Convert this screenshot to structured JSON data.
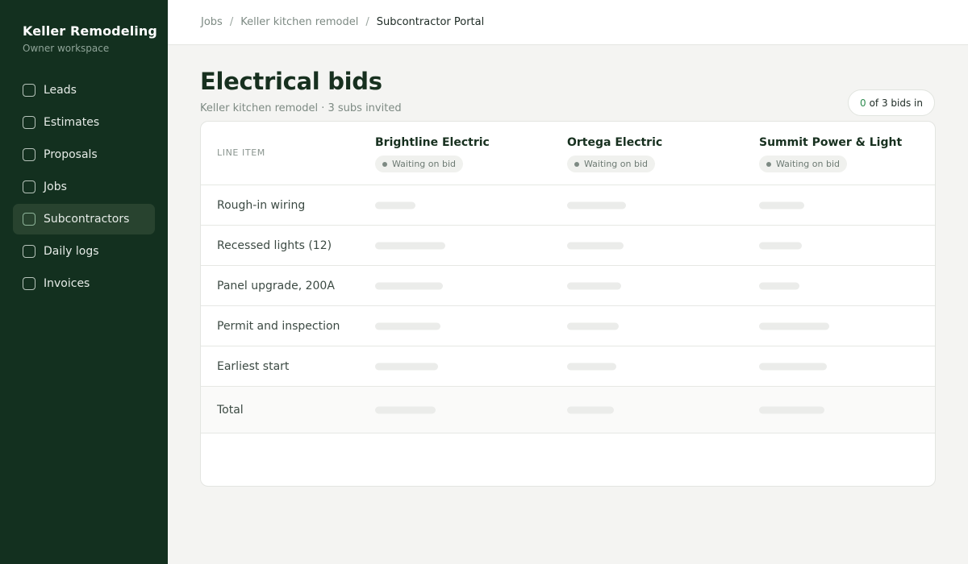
{
  "sidebar": {
    "brand": "Keller Remodeling",
    "workspace": "Owner workspace",
    "items": [
      {
        "label": "Leads",
        "active": false
      },
      {
        "label": "Estimates",
        "active": false
      },
      {
        "label": "Proposals",
        "active": false
      },
      {
        "label": "Jobs",
        "active": false
      },
      {
        "label": "Subcontractors",
        "active": true
      },
      {
        "label": "Daily logs",
        "active": false
      },
      {
        "label": "Invoices",
        "active": false
      }
    ]
  },
  "breadcrumb": {
    "items": [
      "Jobs",
      "Keller kitchen remodel"
    ],
    "current": "Subcontractor Portal",
    "separator": "/"
  },
  "page": {
    "title": "Electrical bids",
    "subtitle": "Keller kitchen remodel · 3 subs invited",
    "bids_received": "0",
    "bids_total_text": "of 3 bids in"
  },
  "table": {
    "line_item_header": "LINE ITEM",
    "bidders": [
      {
        "name": "Brightline Electric",
        "status": "Waiting on bid"
      },
      {
        "name": "Ortega Electric",
        "status": "Waiting on bid"
      },
      {
        "name": "Summit Power & Light",
        "status": "Waiting on bid"
      }
    ],
    "rows": [
      "Rough-in wiring",
      "Recessed lights (12)",
      "Panel upgrade, 200A",
      "Permit and inspection",
      "Earliest start"
    ],
    "total_label": "Total"
  },
  "colors": {
    "sidebar_bg": "#13301f",
    "accent_green": "#2e8b4f",
    "placeholder": "#ebecea"
  }
}
